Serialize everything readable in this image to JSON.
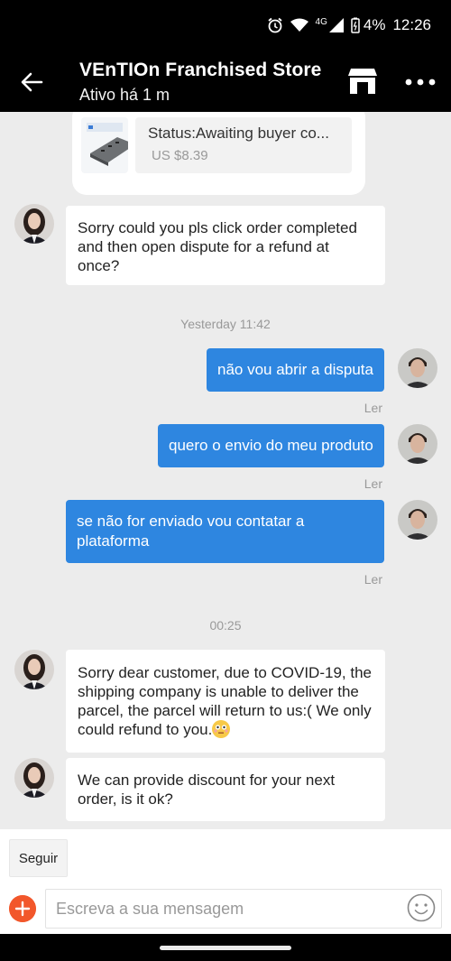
{
  "status_bar": {
    "network": "4G",
    "battery": "4%",
    "time": "12:26"
  },
  "header": {
    "title": "VEnTIOn Franchised Store",
    "subtitle": "Ativo há 1 m",
    "icons": [
      "back-arrow-icon",
      "store-icon",
      "more-icon"
    ]
  },
  "order_card": {
    "status": "Status:Awaiting buyer co...",
    "price": "US $8.39"
  },
  "messages": [
    {
      "from": "seller",
      "text": "Sorry could you pls click order completed and then open dispute for  a refund at once?"
    },
    {
      "timestamp": "Yesterday 11:42"
    },
    {
      "from": "buyer",
      "text": "não vou abrir a disputa",
      "read": "Ler"
    },
    {
      "from": "buyer",
      "text": "quero o envio do meu produto",
      "read": "Ler"
    },
    {
      "from": "buyer",
      "text": "se não for enviado vou contatar a plataforma",
      "read": "Ler"
    },
    {
      "timestamp": "00:25"
    },
    {
      "from": "seller",
      "text": "Sorry dear customer, due to COVID-19, the shipping company is unable to deliver the parcel, the parcel will return to us:( We only could refund to you."
    },
    {
      "from": "seller",
      "text": "We can provide discount for your next order, is it ok?"
    }
  ],
  "bottom_bar": {
    "follow_label": "Seguir",
    "input_placeholder": "Escreva a sua mensagem",
    "input_value": ""
  },
  "colors": {
    "accent_blue": "#2e86e0",
    "add_button": "#f2572b",
    "header_bg": "#000000",
    "chat_bg": "#ececec"
  }
}
